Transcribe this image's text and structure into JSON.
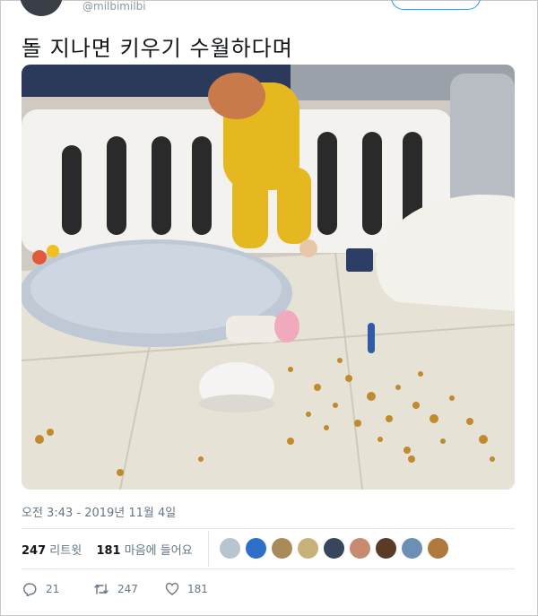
{
  "header": {
    "handle": "@milbimilbi"
  },
  "tweet": {
    "text": "돌 지나면 키우기 수월하다며"
  },
  "meta": {
    "timestamp": "오전 3:43 - 2019년 11월 4일"
  },
  "stats": {
    "retweets_count": "247",
    "retweets_label": "리트윗",
    "likes_count": "181",
    "likes_label": "마음에 들어요"
  },
  "liker_avatars": [
    {
      "color": "#b8c4d0"
    },
    {
      "color": "#2e6fc9"
    },
    {
      "color": "#a98b5a"
    },
    {
      "color": "#c9b27a"
    },
    {
      "color": "#38465c"
    },
    {
      "color": "#c98a72"
    },
    {
      "color": "#5a3b2a"
    },
    {
      "color": "#6b8fb5"
    },
    {
      "color": "#b07a3e"
    }
  ],
  "actions": {
    "reply_count": "21",
    "retweet_count": "247",
    "like_count": "181"
  },
  "colors": {
    "accent": "#1da1f2",
    "muted": "#657786"
  }
}
